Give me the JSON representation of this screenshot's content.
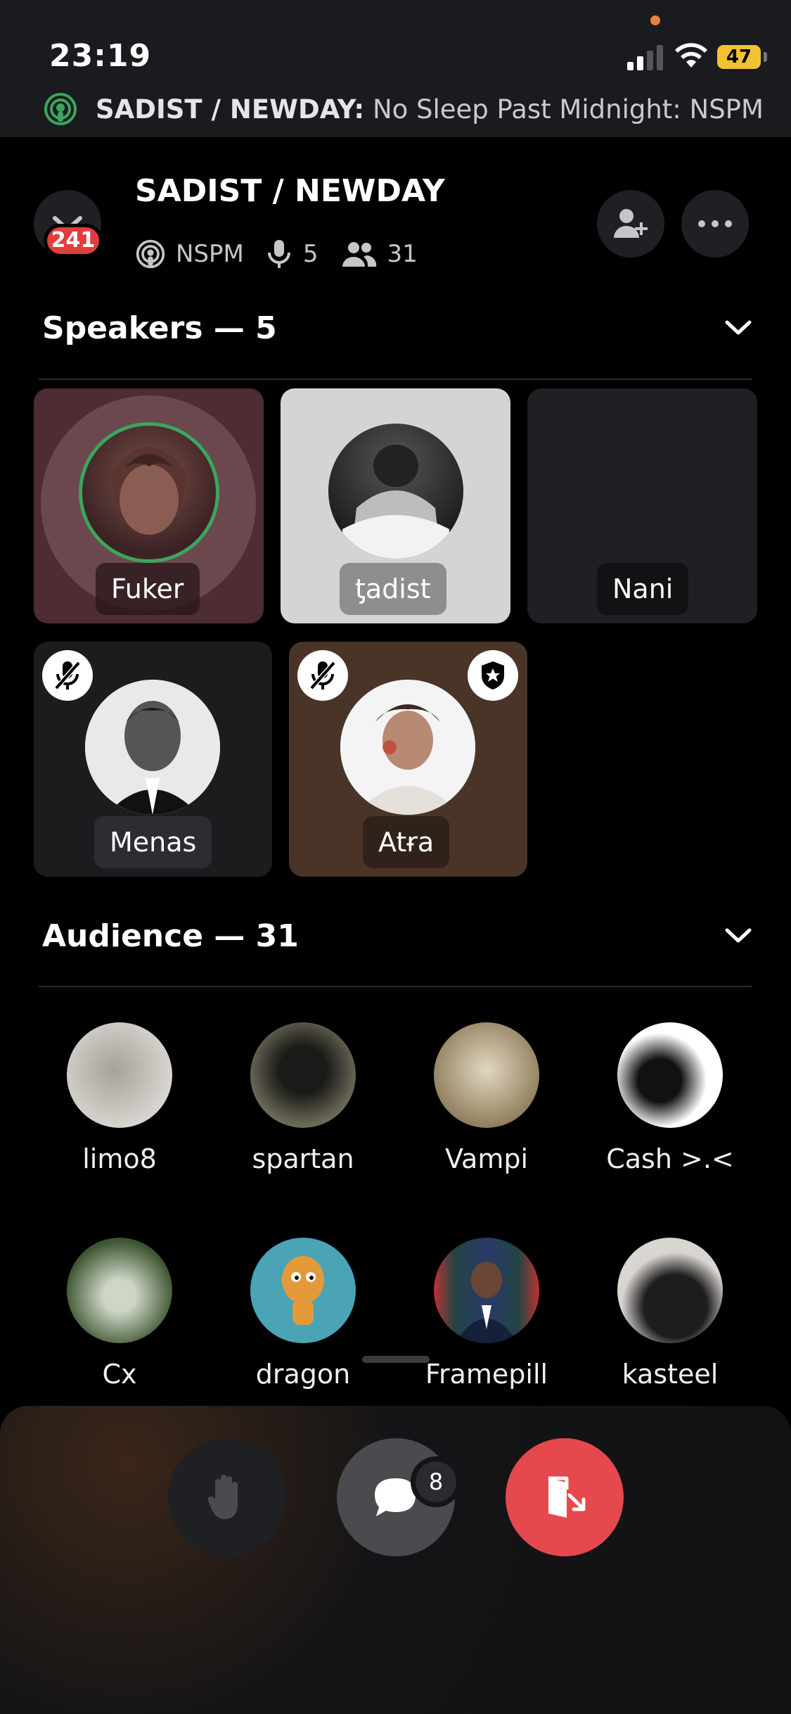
{
  "status_bar": {
    "time": "23:19",
    "battery": "47"
  },
  "live_banner": {
    "channel": "SADIST / NEWDAY:",
    "topic": "No Sleep Past Midnight: NSPM"
  },
  "header": {
    "title": "SADIST / NEWDAY",
    "notification_count": "241",
    "topic_short": "NSPM",
    "speaker_count": "5",
    "listener_count": "31"
  },
  "speakers": {
    "title": "Speakers — 5",
    "tiles": [
      {
        "name": "Fuker",
        "speaking": true,
        "muted": false,
        "moderator": false,
        "bg": "#4e2c33"
      },
      {
        "name": "ƫadist",
        "speaking": false,
        "muted": false,
        "moderator": false,
        "bg": "#d4d4d4"
      },
      {
        "name": "Nani",
        "speaking": false,
        "muted": false,
        "moderator": false,
        "bg": "#1f2024"
      },
      {
        "name": "Menas",
        "speaking": false,
        "muted": true,
        "moderator": false,
        "bg": "#1c1c1e"
      },
      {
        "name": "Atɍa",
        "speaking": false,
        "muted": true,
        "moderator": true,
        "bg": "#4a3428"
      }
    ]
  },
  "audience": {
    "title": "Audience — 31",
    "members": [
      {
        "name": "limo8",
        "color": "#c9c3bc"
      },
      {
        "name": "spartan",
        "color": "#4c4b3f"
      },
      {
        "name": "Vampi",
        "color": "#a79a78"
      },
      {
        "name": "Cash >.<",
        "color": "#ffffff"
      },
      {
        "name": "Cx",
        "color": "#4f6a3e"
      },
      {
        "name": "dragon",
        "color": "#4ba3b6"
      },
      {
        "name": "Framepill",
        "color": "#3a4f7a"
      },
      {
        "name": "kasteel",
        "color": "#d9d6d2"
      }
    ]
  },
  "controls": {
    "unread_messages": "8"
  },
  "colors": {
    "speaking_ring": "#3ba55d",
    "leave_red": "#e5484d",
    "badge_red": "#e03e3e",
    "battery_yellow": "#f1c232",
    "live_green": "#3ba55d"
  }
}
